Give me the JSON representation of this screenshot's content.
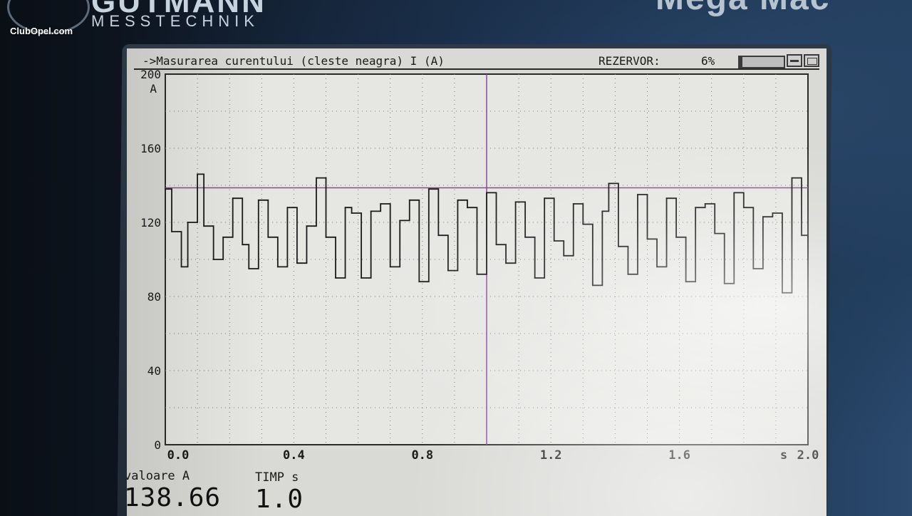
{
  "watermark": "ClubOpel.com",
  "device": {
    "brand": "GUTMANN",
    "brand_sub": "MESSTECHNIK",
    "product": "Mega Mac"
  },
  "screen": {
    "title": "->Masurarea curentului (cleste neagra) I (A)",
    "reservoir_label": "REZERVOR:",
    "reservoir_value": "6%",
    "reservoir_fraction": 0.06,
    "icons": [
      "print-icon",
      "monitor-icon"
    ]
  },
  "readout": {
    "value_label": "valoare A",
    "value": "138.66",
    "time_label": "TIMP s",
    "time": "1.0"
  },
  "chart_data": {
    "type": "line",
    "title": "",
    "xlabel": "s",
    "ylabel": "A",
    "xlim": [
      0,
      2.0
    ],
    "ylim": [
      0,
      200
    ],
    "x_ticks": [
      "0.0",
      "0.4",
      "0.8",
      "1.2",
      "1.6",
      "2.0"
    ],
    "y_ticks": [
      "0",
      "40",
      "80",
      "120",
      "160",
      "200"
    ],
    "grid": true,
    "cursor": {
      "x": 1.0,
      "y": 138.66
    },
    "series": [
      {
        "x": [
          0.0,
          0.02,
          0.05,
          0.07,
          0.1,
          0.12,
          0.15,
          0.18,
          0.21,
          0.24,
          0.26,
          0.29,
          0.32,
          0.35,
          0.38,
          0.41,
          0.44,
          0.47,
          0.5,
          0.53,
          0.56,
          0.58,
          0.61,
          0.64,
          0.67,
          0.7,
          0.73,
          0.76,
          0.79,
          0.82,
          0.85,
          0.88,
          0.91,
          0.94,
          0.97,
          1.0,
          1.03,
          1.06,
          1.09,
          1.12,
          1.15,
          1.18,
          1.21,
          1.24,
          1.27,
          1.3,
          1.33,
          1.36,
          1.38,
          1.41,
          1.44,
          1.47,
          1.5,
          1.53,
          1.56,
          1.59,
          1.62,
          1.65,
          1.68,
          1.71,
          1.74,
          1.77,
          1.8,
          1.83,
          1.86,
          1.89,
          1.92,
          1.95,
          1.98,
          2.0
        ],
        "y": [
          138,
          115,
          96,
          120,
          146,
          118,
          100,
          112,
          133,
          108,
          95,
          132,
          112,
          96,
          128,
          98,
          118,
          144,
          112,
          90,
          128,
          125,
          90,
          126,
          130,
          96,
          121,
          132,
          88,
          138,
          113,
          94,
          132,
          128,
          92,
          136,
          108,
          98,
          131,
          112,
          90,
          133,
          110,
          102,
          130,
          119,
          86,
          126,
          141,
          107,
          92,
          135,
          111,
          96,
          133,
          112,
          88,
          128,
          130,
          114,
          87,
          136,
          128,
          95,
          123,
          125,
          82,
          144,
          113,
          100
        ]
      }
    ]
  }
}
